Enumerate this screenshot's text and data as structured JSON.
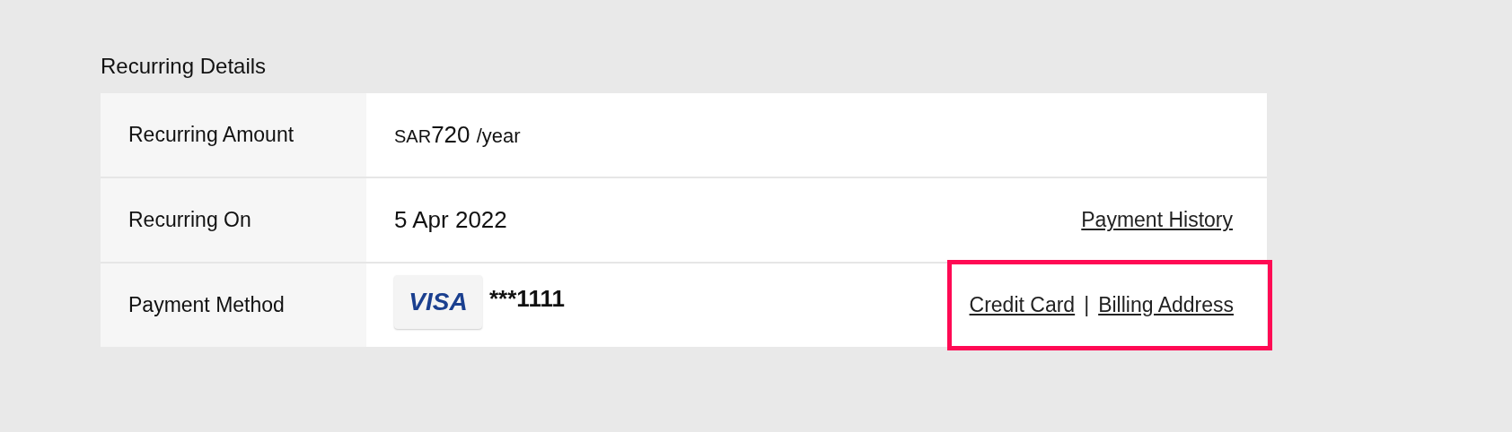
{
  "section_title": "Recurring Details",
  "rows": [
    {
      "kind": "amount",
      "label": "Recurring Amount",
      "currency": "SAR",
      "amount": "720",
      "period": "/year"
    },
    {
      "kind": "date",
      "label": "Recurring On",
      "value": "5 Apr 2022",
      "links": [
        "Payment History"
      ]
    },
    {
      "kind": "card",
      "label": "Payment Method",
      "card_brand": "VISA",
      "card_number": "***1111",
      "links": [
        "Credit Card",
        "Billing Address"
      ],
      "separator": "|",
      "highlighted": true
    }
  ]
}
